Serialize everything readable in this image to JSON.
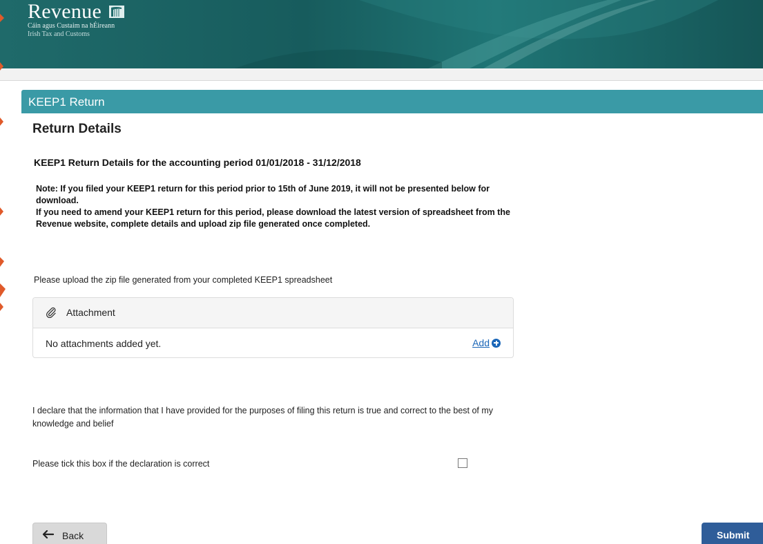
{
  "header": {
    "brand_name": "Revenue",
    "brand_subtitle_irish": "Cáin agus Custaim na hÉireann",
    "brand_subtitle_english": "Irish Tax and Customs"
  },
  "section": {
    "title": "KEEP1 Return"
  },
  "main": {
    "heading": "Return Details",
    "period_heading": "KEEP1 Return Details for the accounting period 01/01/2018 - 31/12/2018",
    "note_line1": "Note: If you filed your KEEP1 return for this period prior to 15th of June 2019, it will not be presented below for download.",
    "note_line2": "If you need to amend your KEEP1 return for this period, please download the latest version of spreadsheet from the Revenue website, complete details and upload zip file generated once completed.",
    "upload_instruction": "Please upload the zip file generated from your completed KEEP1 spreadsheet"
  },
  "attachments": {
    "title": "Attachment",
    "empty_text": "No attachments added yet.",
    "add_label": "Add"
  },
  "declaration": {
    "text": "I declare that the information that I have provided for the purposes of filing this return is true and correct to the best of my knowledge and belief",
    "tick_label": "Please tick this box if the declaration is correct",
    "checked": false
  },
  "footer": {
    "back_label": "Back",
    "submit_label": "Submit"
  },
  "colors": {
    "banner": "#1f6a6a",
    "section_header": "#3a9aa6",
    "link": "#1a66b8",
    "submit": "#2f5d99"
  },
  "icons": [
    "harp-icon",
    "paperclip-icon",
    "plus-circle-icon",
    "arrow-left-icon"
  ]
}
